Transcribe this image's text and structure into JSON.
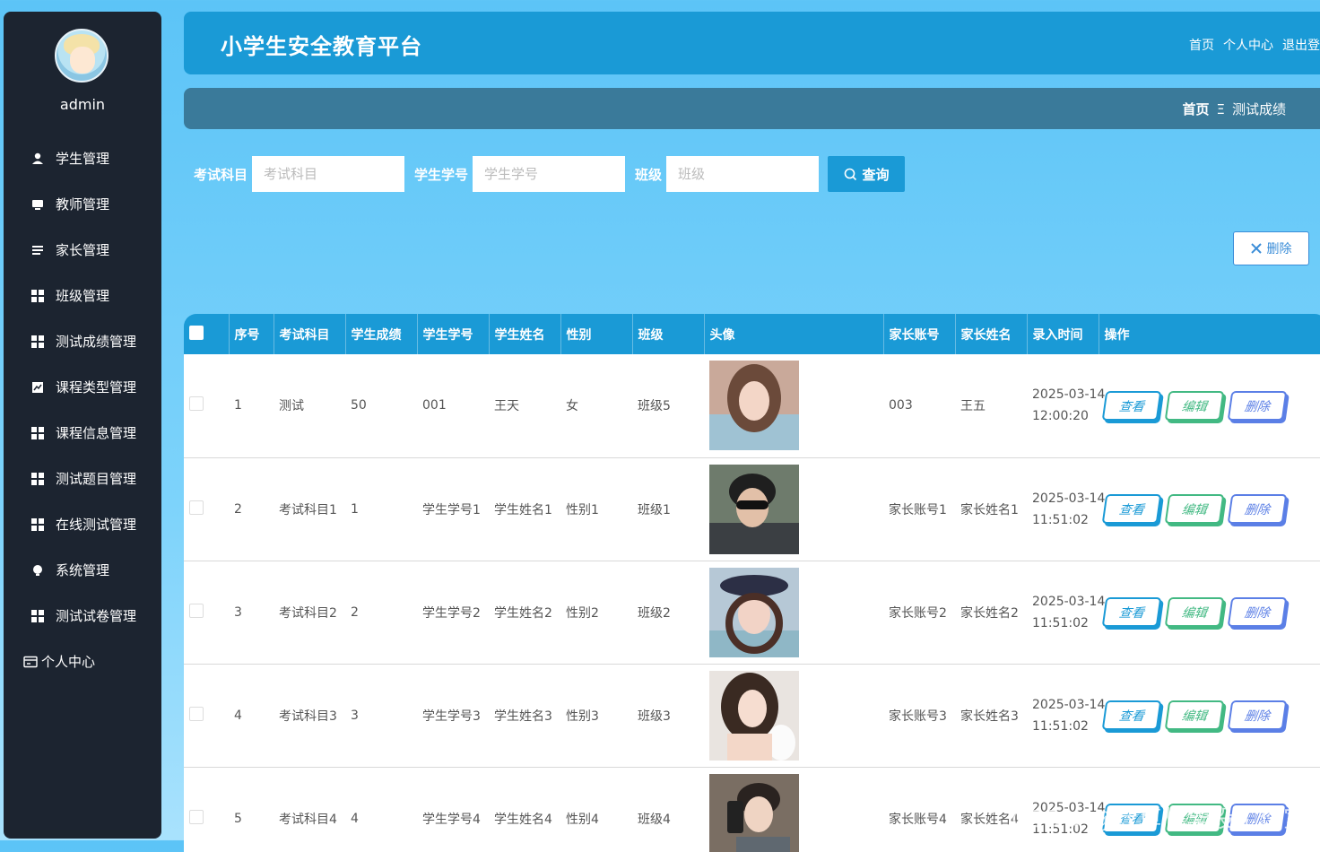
{
  "sidebar": {
    "username": "admin",
    "items": [
      {
        "label": "学生管理",
        "icon": "user-icon"
      },
      {
        "label": "教师管理",
        "icon": "monitor-icon"
      },
      {
        "label": "家长管理",
        "icon": "list-icon"
      },
      {
        "label": "班级管理",
        "icon": "grid-icon"
      },
      {
        "label": "测试成绩管理",
        "icon": "grid-icon"
      },
      {
        "label": "课程类型管理",
        "icon": "chart-icon"
      },
      {
        "label": "课程信息管理",
        "icon": "grid-icon"
      },
      {
        "label": "测试题目管理",
        "icon": "grid-icon"
      },
      {
        "label": "在线测试管理",
        "icon": "grid-icon"
      },
      {
        "label": "系统管理",
        "icon": "bulb-icon"
      },
      {
        "label": "测试试卷管理",
        "icon": "grid-icon"
      },
      {
        "label": "个人中心",
        "icon": "card-icon"
      }
    ]
  },
  "header": {
    "title": "小学生安全教育平台",
    "links": [
      "首页",
      "个人中心",
      "退出登"
    ]
  },
  "breadcrumb": {
    "home": "首页",
    "separator": "Ξ",
    "current": "测试成绩"
  },
  "search": {
    "subject_label": "考试科目",
    "subject_placeholder": "考试科目",
    "student_no_label": "学生学号",
    "student_no_placeholder": "学生学号",
    "class_label": "班级",
    "class_placeholder": "班级",
    "query_label": "查询"
  },
  "toolbar": {
    "delete_label": "删除"
  },
  "table": {
    "columns": [
      "序号",
      "考试科目",
      "学生成绩",
      "学生学号",
      "学生姓名",
      "性别",
      "班级",
      "头像",
      "家长账号",
      "家长姓名",
      "录入时间",
      "操作"
    ],
    "rows": [
      {
        "no": "1",
        "subject": "测试",
        "score": "50",
        "student_no": "001",
        "student_name": "王天",
        "gender": "女",
        "class": "班级5",
        "parent_account": "003",
        "parent_name": "王五",
        "date": "2025-03-14",
        "time": "12:00:20"
      },
      {
        "no": "2",
        "subject": "考试科目1",
        "score": "1",
        "student_no": "学生学号1",
        "student_name": "学生姓名1",
        "gender": "性别1",
        "class": "班级1",
        "parent_account": "家长账号1",
        "parent_name": "家长姓名1",
        "date": "2025-03-14",
        "time": "11:51:02"
      },
      {
        "no": "3",
        "subject": "考试科目2",
        "score": "2",
        "student_no": "学生学号2",
        "student_name": "学生姓名2",
        "gender": "性别2",
        "class": "班级2",
        "parent_account": "家长账号2",
        "parent_name": "家长姓名2",
        "date": "2025-03-14",
        "time": "11:51:02"
      },
      {
        "no": "4",
        "subject": "考试科目3",
        "score": "3",
        "student_no": "学生学号3",
        "student_name": "学生姓名3",
        "gender": "性别3",
        "class": "班级3",
        "parent_account": "家长账号3",
        "parent_name": "家长姓名3",
        "date": "2025-03-14",
        "time": "11:51:02"
      },
      {
        "no": "5",
        "subject": "考试科目4",
        "score": "4",
        "student_no": "学生学号4",
        "student_name": "学生姓名4",
        "gender": "性别4",
        "class": "班级4",
        "parent_account": "家长账号4",
        "parent_name": "家长姓名4",
        "date": "2025-03-14",
        "time": "11:51:02"
      }
    ],
    "actions": {
      "view": "查看",
      "edit": "编辑",
      "delete": "删除"
    }
  },
  "watermark": "CSDN @计算机毕设工作室",
  "colors": {
    "header": "#1a9ad6",
    "sidebar": "#1c2430",
    "breadcrumb": "#3a7a9a",
    "edit": "#42b983",
    "delete": "#5b7fe6"
  }
}
